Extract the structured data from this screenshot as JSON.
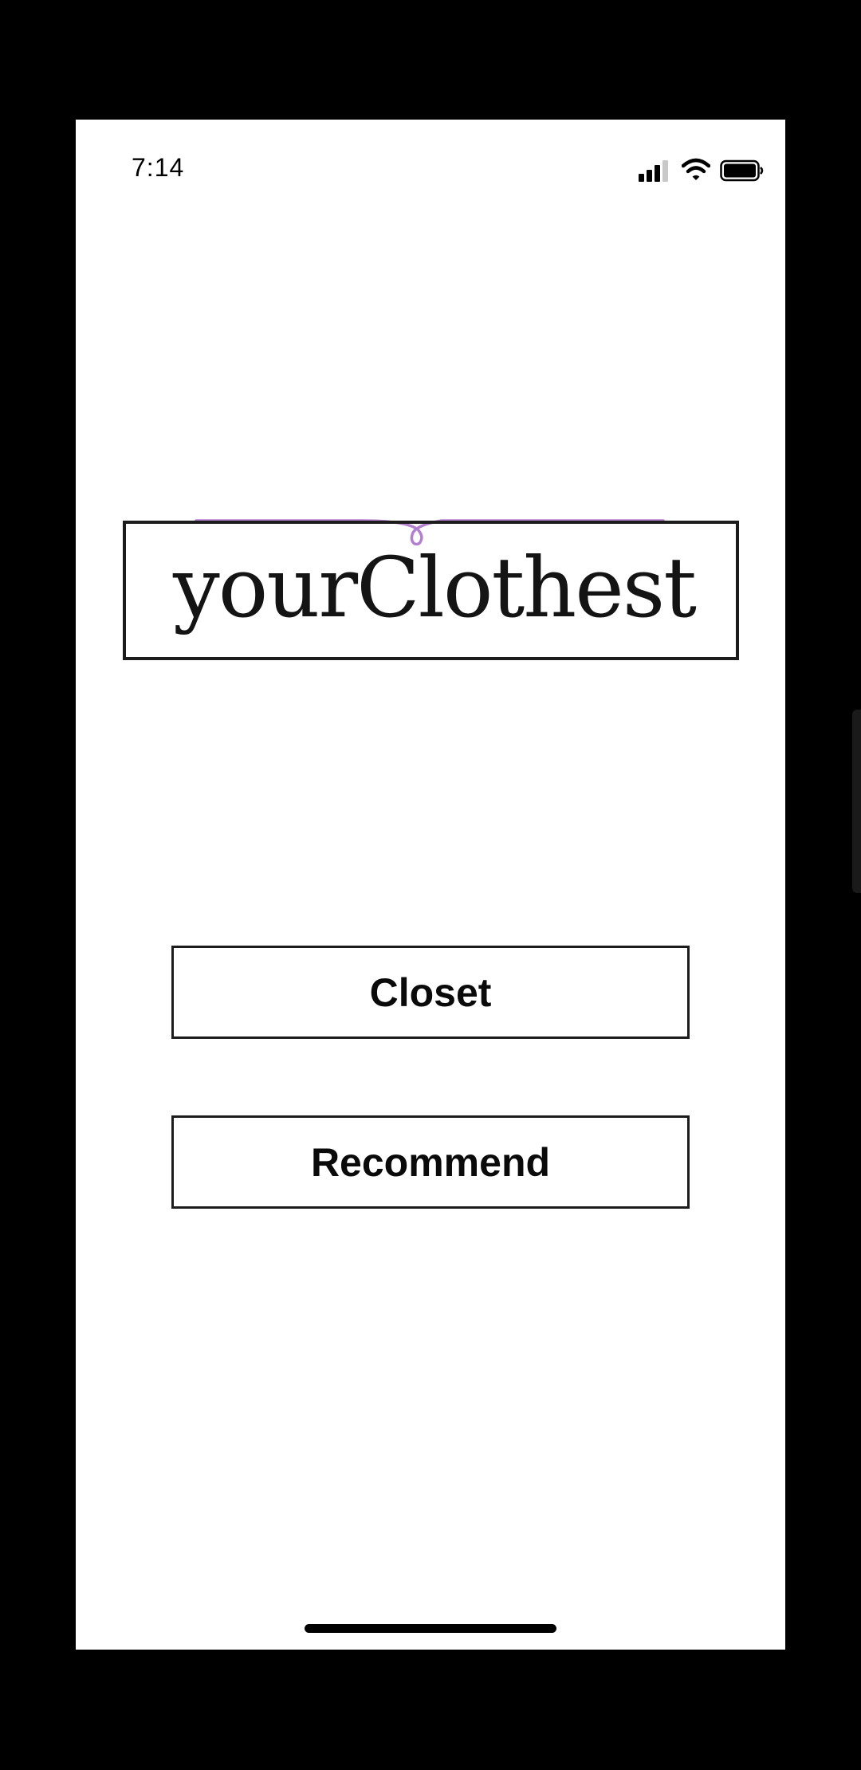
{
  "status_bar": {
    "time": "7:14",
    "icons": [
      "signal-bars-icon",
      "wifi-icon",
      "battery-icon"
    ]
  },
  "logo": {
    "text": "yourClothest",
    "accent_color": "#b57fd0"
  },
  "buttons": {
    "closet_label": "Closet",
    "recommend_label": "Recommend"
  }
}
